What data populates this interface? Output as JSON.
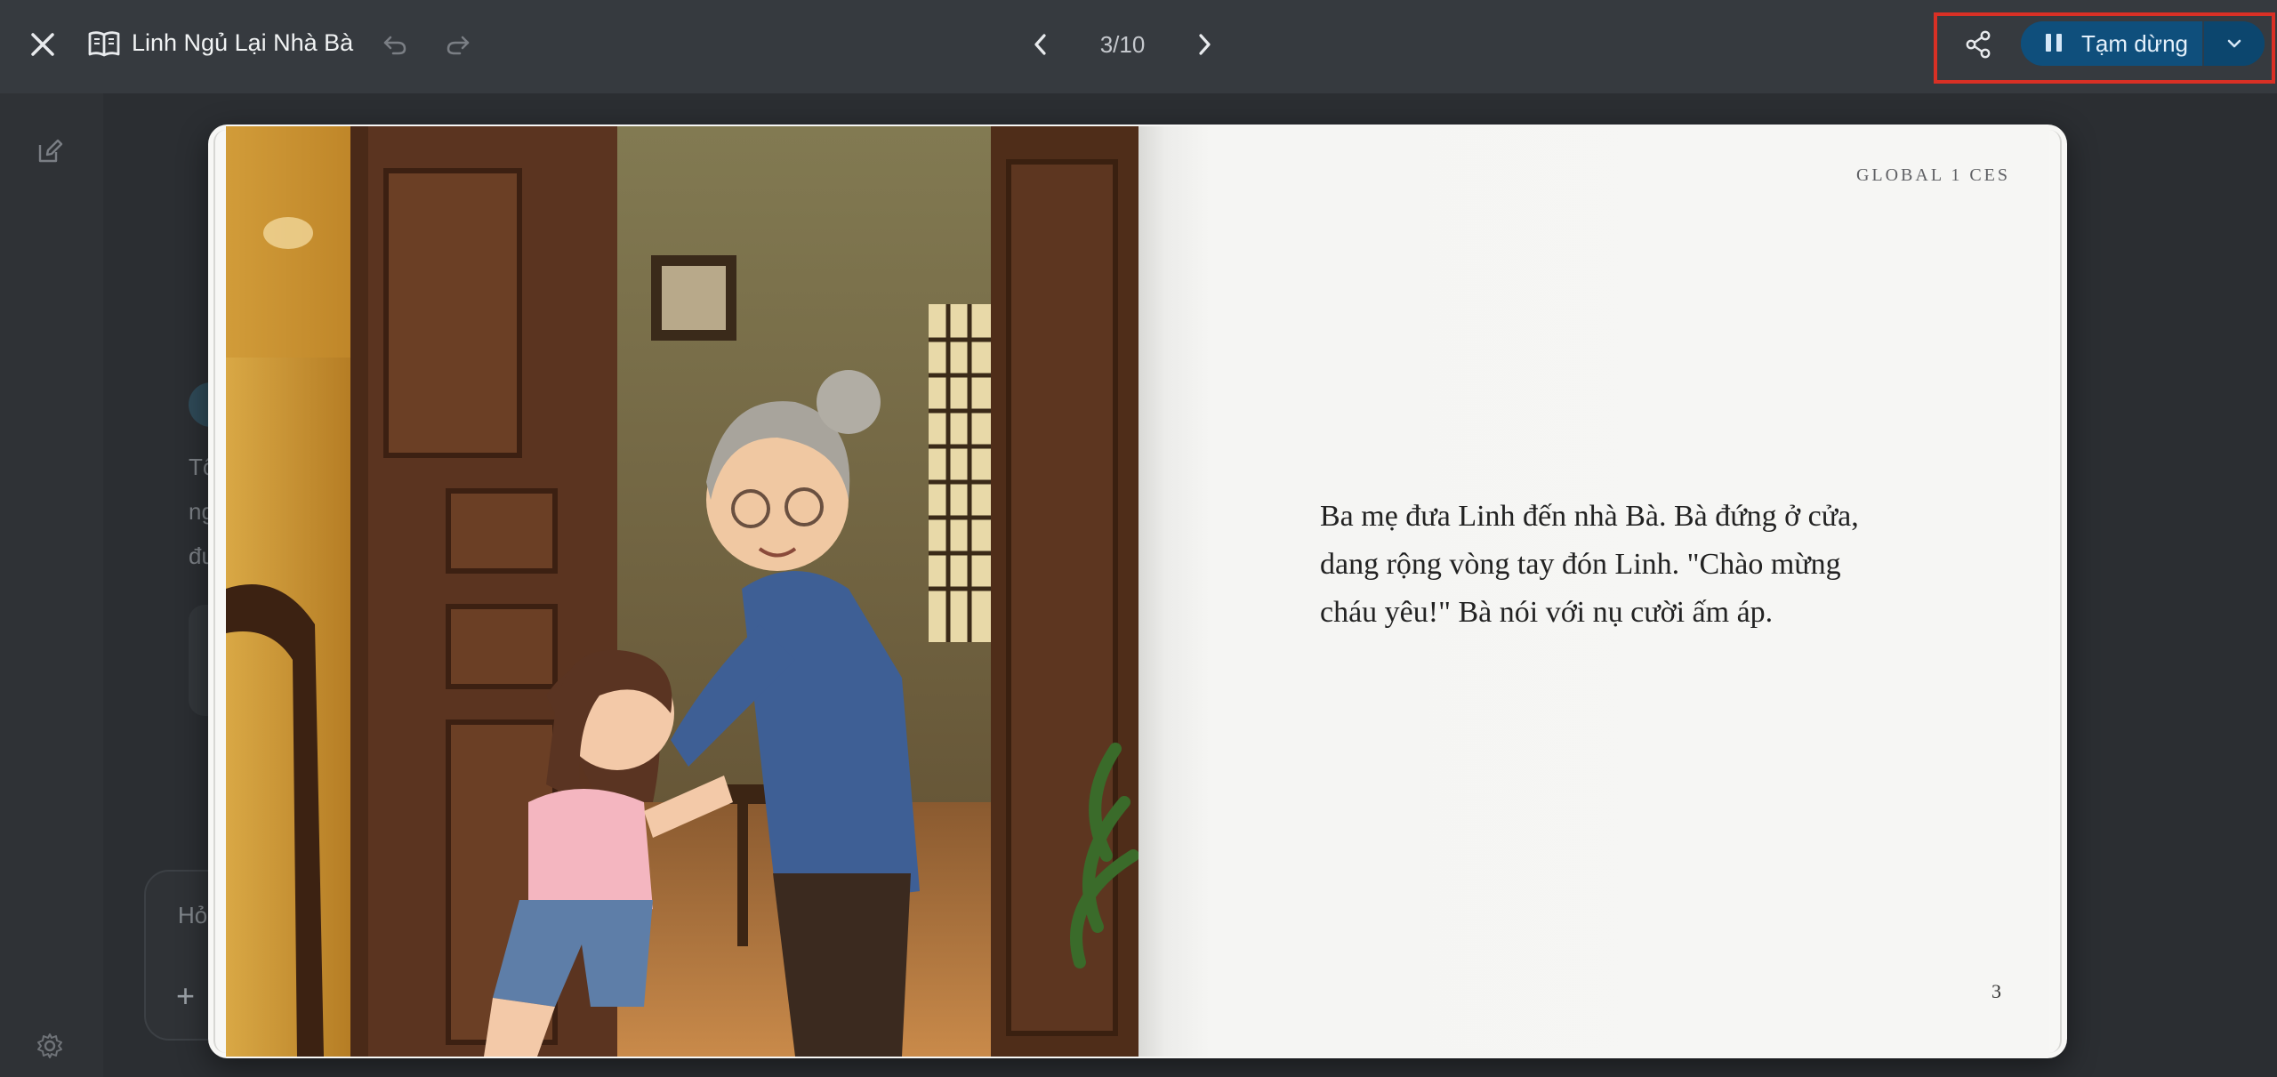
{
  "header": {
    "title": "Linh Ngủ Lại Nhà Bà",
    "page_indicator": "3/10",
    "pause_label": "Tạm dừng",
    "icons": {
      "close": "close-icon",
      "book": "book-icon",
      "undo": "undo-icon",
      "redo": "redo-icon",
      "prev": "chevron-left-icon",
      "next": "chevron-right-icon",
      "share": "share-icon",
      "pause": "pause-icon",
      "dropdown": "chevron-down-icon"
    }
  },
  "sidebar": {
    "icons": [
      "edit-icon",
      "settings-icon"
    ]
  },
  "background": {
    "snippet_lines": [
      "Tô",
      "ng",
      "đư"
    ],
    "input_placeholder": "Hỏ",
    "plus": "+"
  },
  "book": {
    "running_head": "GLOBAL 1 CES",
    "text": "Ba mẹ đưa Linh đến nhà Bà. Bà đứng ở cửa, dang rộng vòng tay đón Linh. \"Chào mừng cháu yêu!\" Bà nói với nụ cười ấm áp.",
    "page_number": "3",
    "illustration_description_icon": "story-illustration"
  },
  "colors": {
    "topbar": "#363a3f",
    "background": "#2b2e32",
    "pause_button": "#0f4f7c",
    "highlight": "#d93025"
  }
}
